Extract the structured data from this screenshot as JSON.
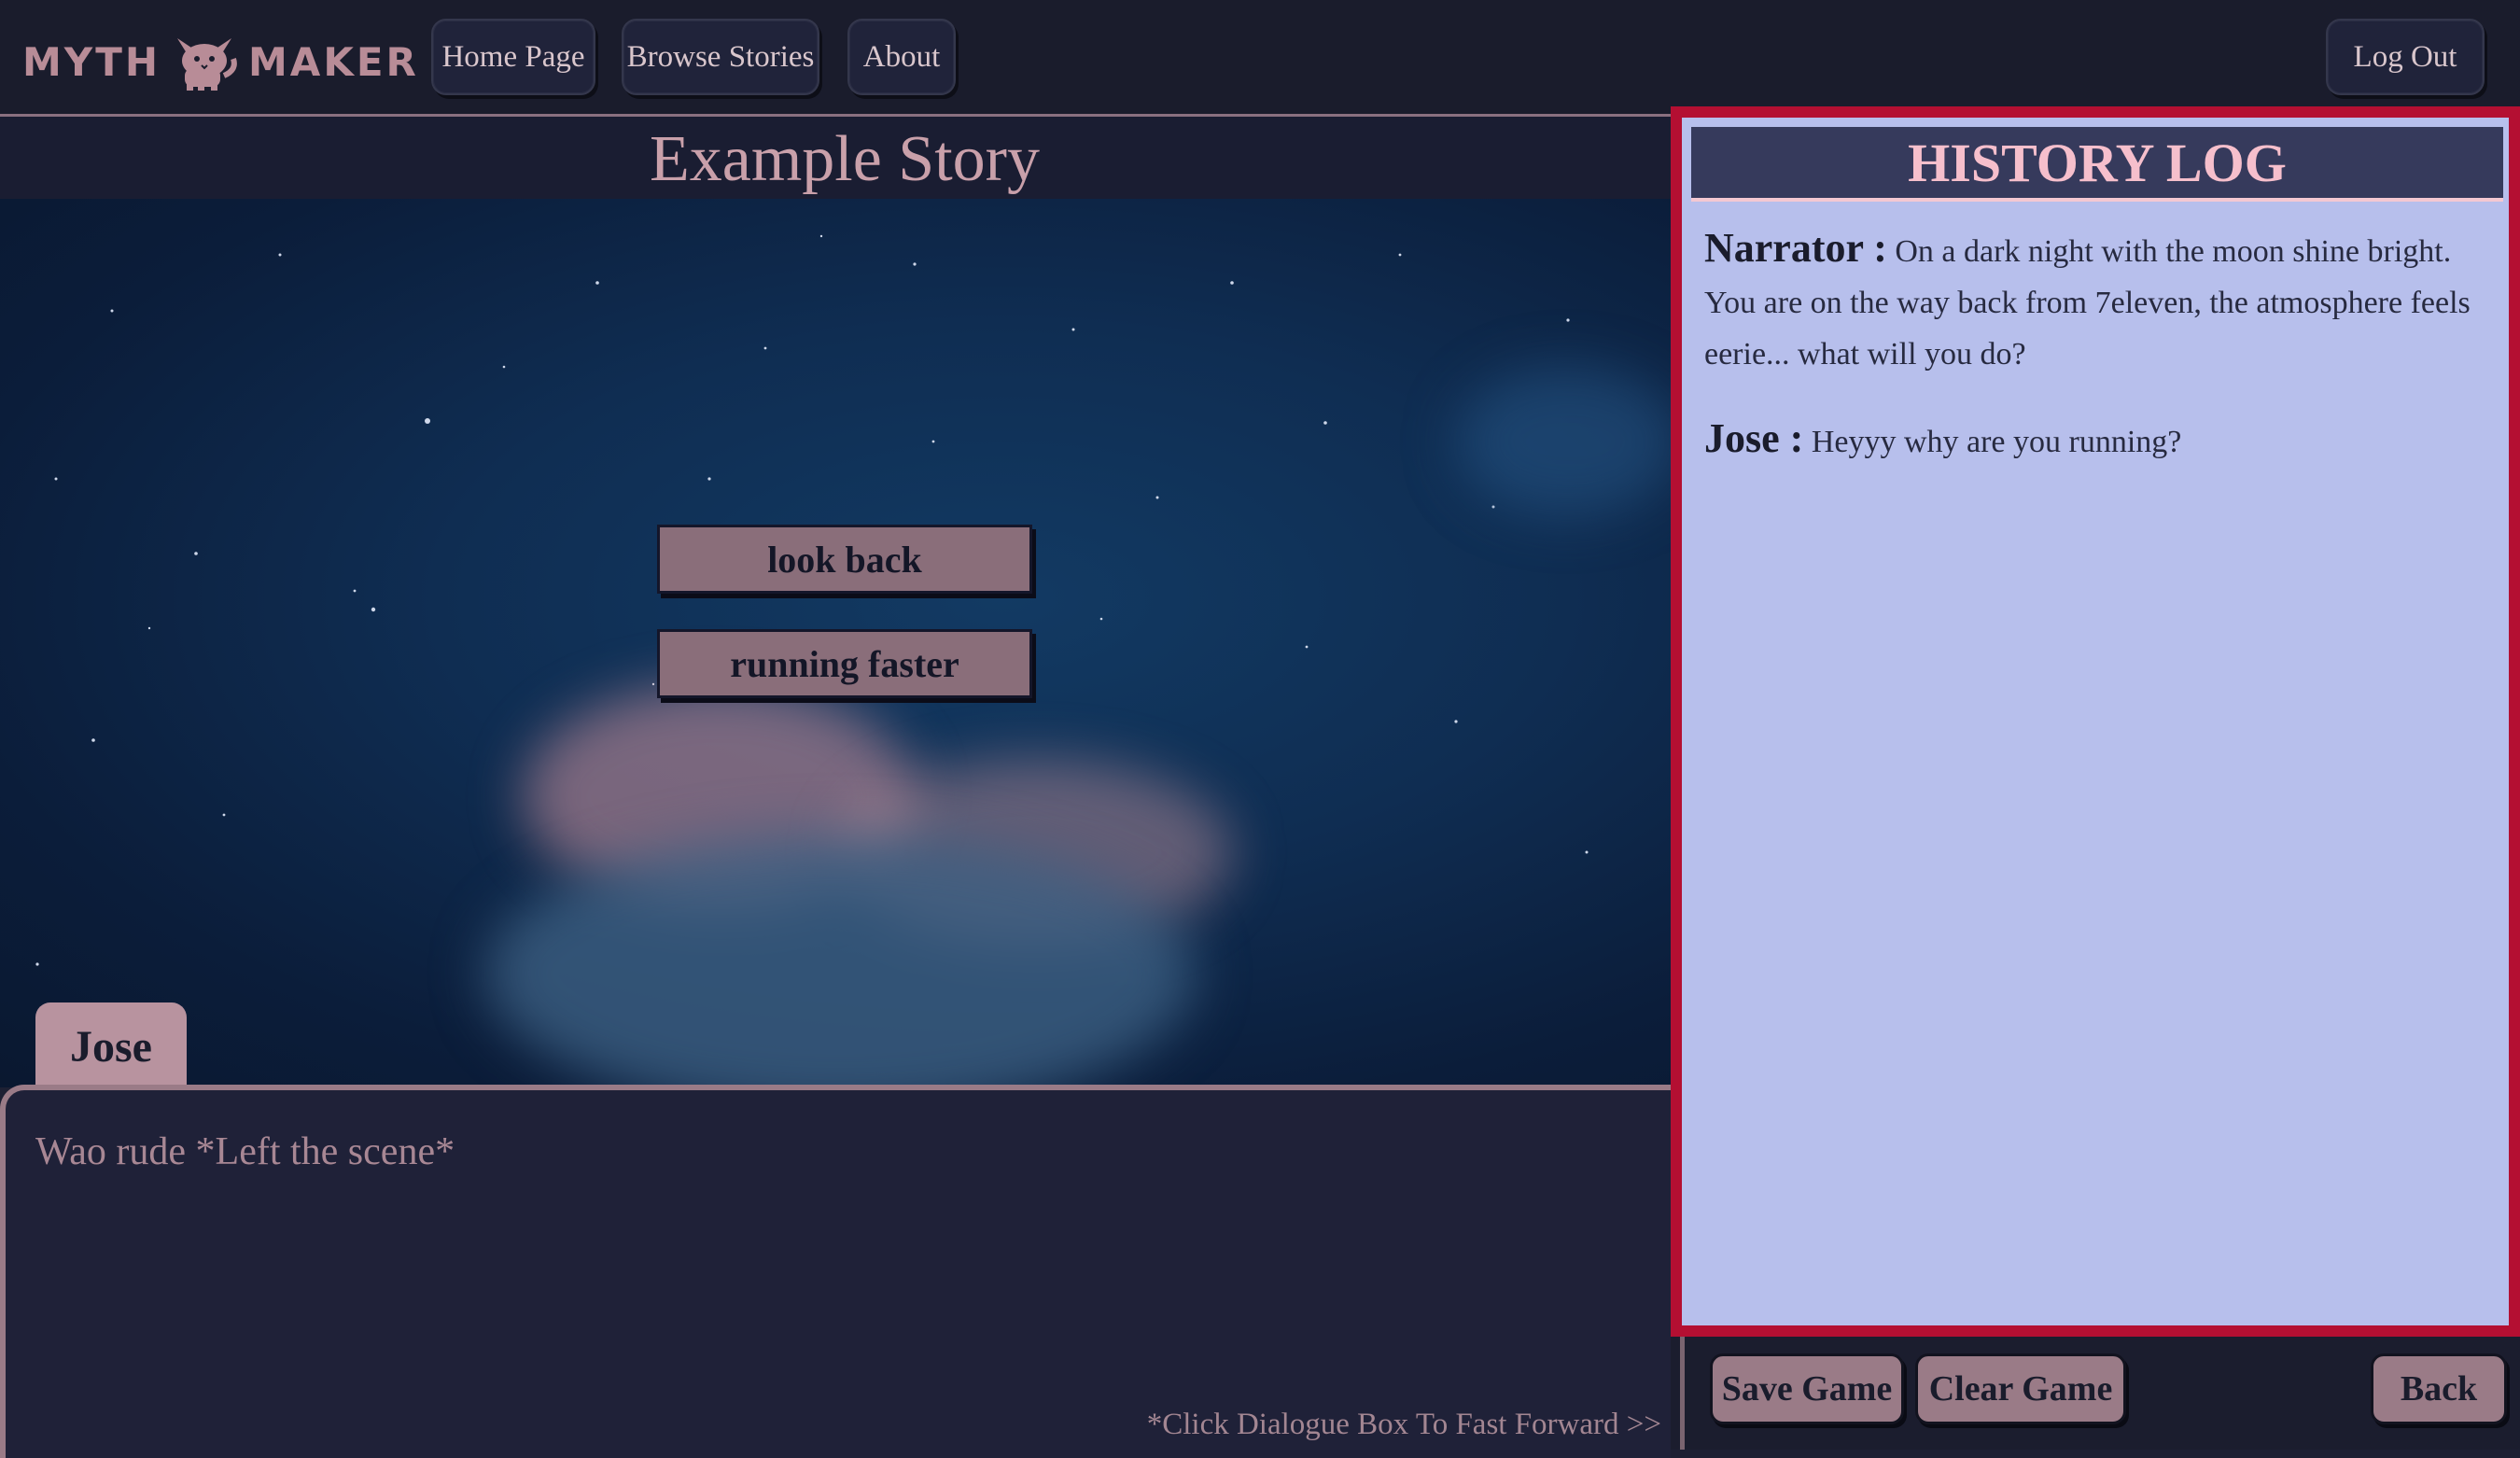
{
  "navbar": {
    "logo_left": "MYTH",
    "logo_right": "MAKER",
    "logo_icon": "cat-mascot-icon",
    "links": [
      {
        "label": "Home Page"
      },
      {
        "label": "Browse Stories"
      },
      {
        "label": "About"
      }
    ],
    "logout_label": "Log Out"
  },
  "story": {
    "title": "Example Story",
    "choices": [
      {
        "label": "look back"
      },
      {
        "label": "running faster"
      }
    ]
  },
  "dialogue": {
    "speaker": "Jose",
    "text": "Wao rude *Left the scene*",
    "hint": "*Click Dialogue Box To Fast Forward >>"
  },
  "history": {
    "title": "HISTORY LOG",
    "entries": [
      {
        "speaker": "Narrator :",
        "text": "On a dark night with the moon shine bright. You are on the way back from 7eleven, the atmosphere feels eerie... what will you do?"
      },
      {
        "speaker": "Jose :",
        "text": "Heyyy why are you running?"
      }
    ]
  },
  "actions": {
    "save_label": "Save Game",
    "clear_label": "Clear Game",
    "back_label": "Back"
  },
  "colors": {
    "accent_pink": "#f6bfcc",
    "panel_highlight": "#b40f32",
    "history_bg": "#b7bfec",
    "button_mauve": "#9a7b87"
  }
}
